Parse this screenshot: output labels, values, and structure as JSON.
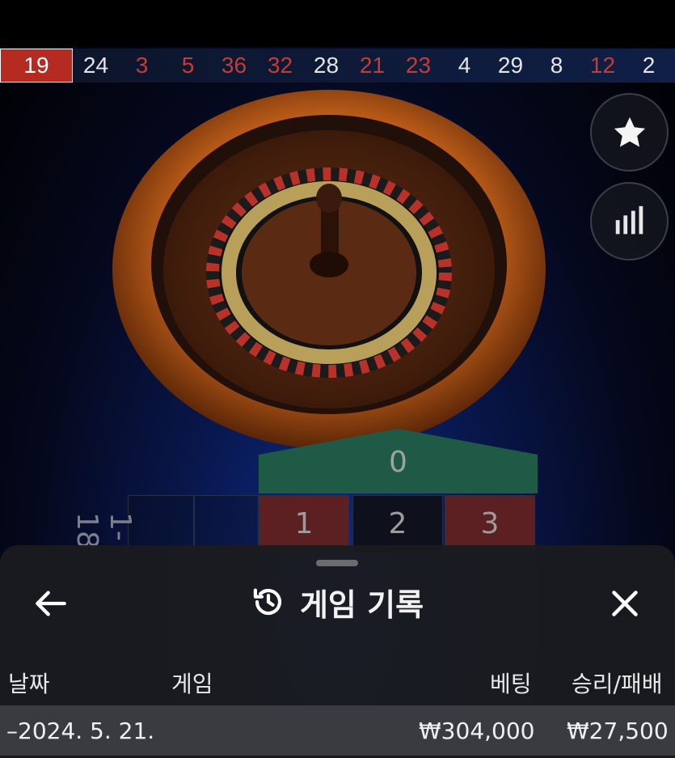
{
  "history": [
    {
      "n": "19",
      "color": "red"
    },
    {
      "n": "24",
      "color": "black"
    },
    {
      "n": "3",
      "color": "red"
    },
    {
      "n": "5",
      "color": "red"
    },
    {
      "n": "36",
      "color": "red"
    },
    {
      "n": "32",
      "color": "red"
    },
    {
      "n": "28",
      "color": "black"
    },
    {
      "n": "21",
      "color": "red"
    },
    {
      "n": "23",
      "color": "red"
    },
    {
      "n": "4",
      "color": "black"
    },
    {
      "n": "29",
      "color": "black"
    },
    {
      "n": "8",
      "color": "black"
    },
    {
      "n": "12",
      "color": "red"
    },
    {
      "n": "2",
      "color": "black"
    }
  ],
  "side_buttons": {
    "favorite_icon": "star-icon",
    "stats_icon": "bar-chart-icon"
  },
  "table": {
    "zero": "0",
    "row1": [
      "1",
      "2",
      "3"
    ],
    "side_label": "1-18"
  },
  "sheet": {
    "title": "게임 기록",
    "back_icon": "arrow-left-icon",
    "history_icon": "history-icon",
    "close_icon": "close-icon",
    "columns": {
      "date": "날짜",
      "game": "게임",
      "bet": "베팅",
      "winloss": "승리/패배"
    },
    "rows": [
      {
        "date": "–2024. 5. 21.",
        "bet": "₩304,000",
        "winloss": "₩27,500"
      }
    ]
  }
}
